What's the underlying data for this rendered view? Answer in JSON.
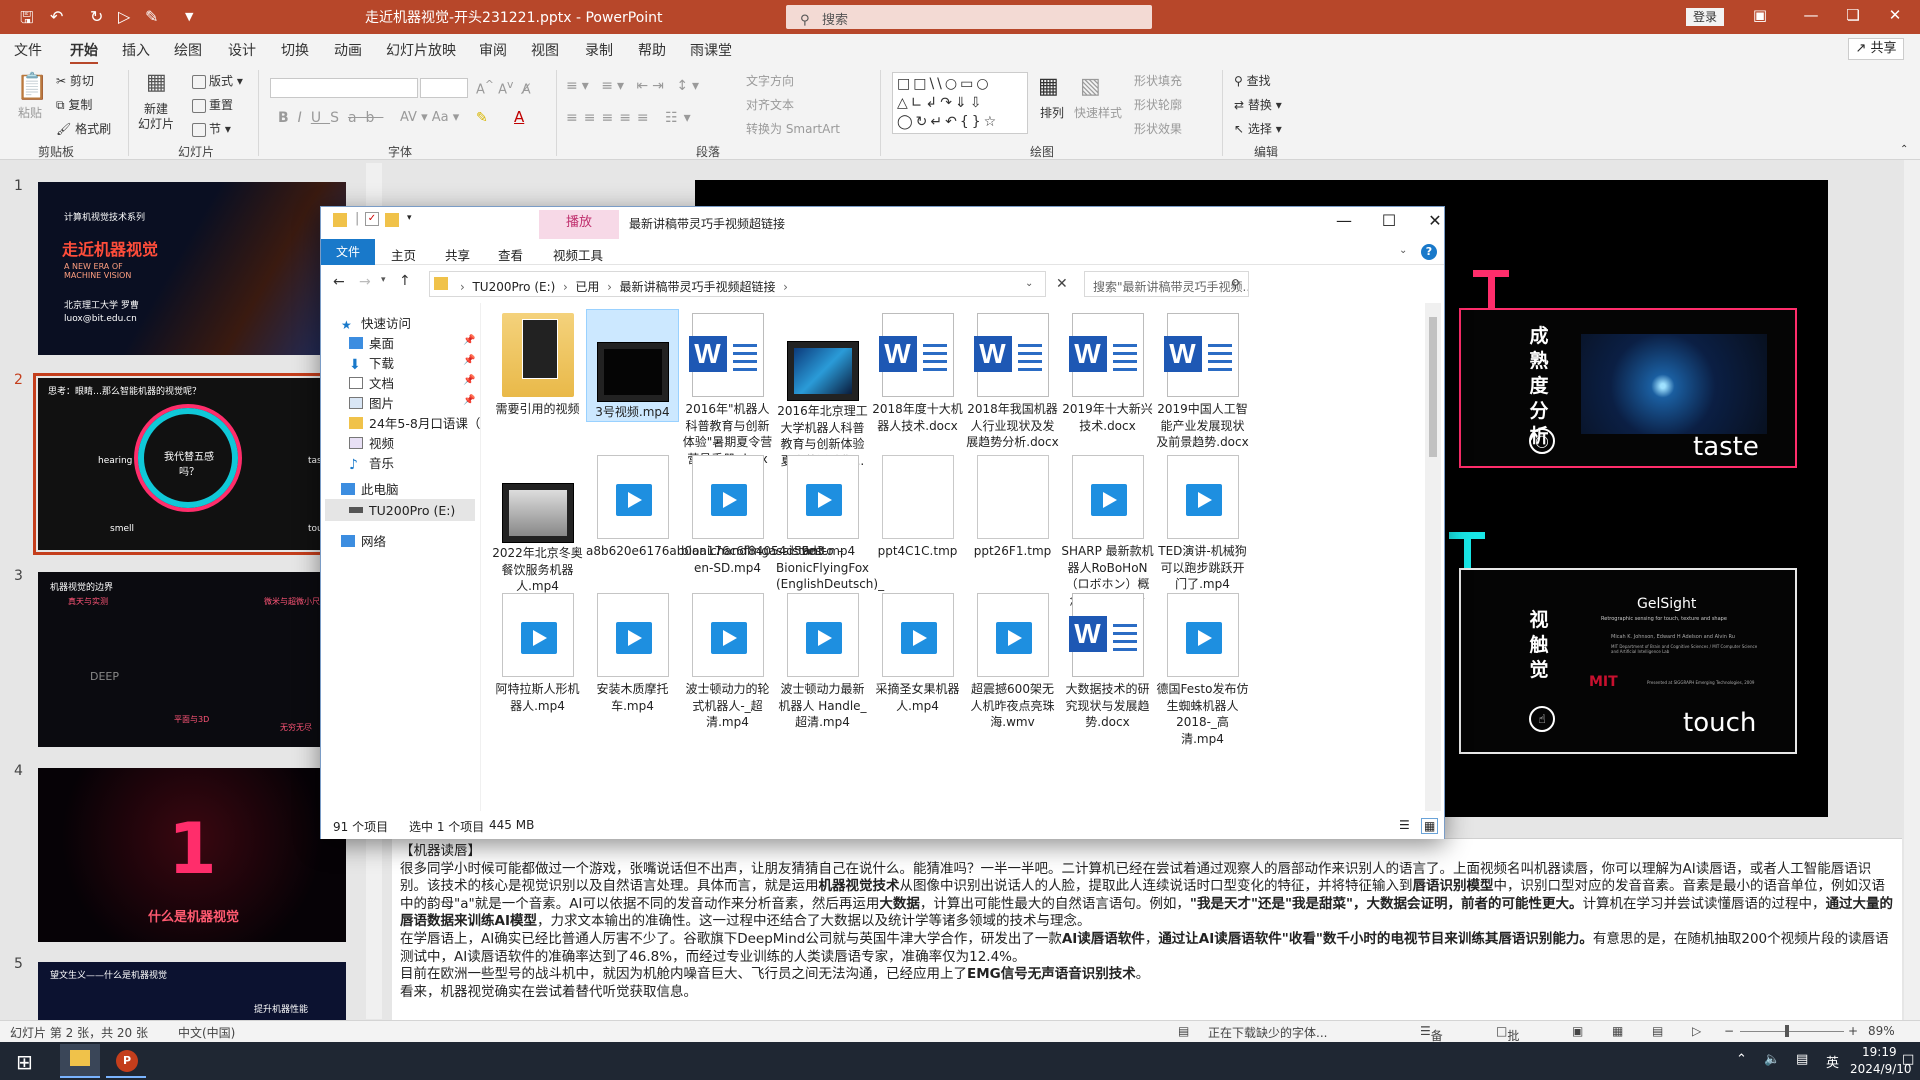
{
  "ppt": {
    "title": "走近机器视觉-开头231221.pptx - PowerPoint",
    "search_placeholder": "搜索",
    "login": "登录",
    "share": "共享",
    "menu": [
      "文件",
      "开始",
      "插入",
      "绘图",
      "设计",
      "切换",
      "动画",
      "幻灯片放映",
      "审阅",
      "视图",
      "录制",
      "帮助",
      "雨课堂"
    ],
    "ribbon": {
      "paste": "粘贴",
      "cut": "剪切",
      "copy": "复制",
      "format_painter": "格式刷",
      "new_slide": "新建\n幻灯片",
      "layout": "版式",
      "reset": "重置",
      "section": "节",
      "text_direction": "文字方向",
      "align_text": "对齐文本",
      "smartart": "转换为 SmartArt",
      "arrange": "排列",
      "quick_styles": "快速样式",
      "shape_fill": "形状填充",
      "shape_outline": "形状轮廓",
      "shape_effects": "形状效果",
      "find": "查找",
      "replace": "替换",
      "select": "选择",
      "groups": [
        "剪贴板",
        "幻灯片",
        "字体",
        "段落",
        "绘图",
        "编辑"
      ]
    },
    "slides": [
      {
        "num": "1",
        "title": "走近机器视觉",
        "subtitle": "A NEW ERA OF MACHINE VISION",
        "series": "计算机视觉技术系列",
        "author": "北京理工大学 罗曹",
        "email": "luox@bit.edu.cn"
      },
      {
        "num": "2",
        "title": "思考：眼睛…那么智能机器的视觉呢？",
        "center": "我代替五感吗？",
        "labels": [
          "hearing",
          "smell",
          "taste",
          "touch"
        ]
      },
      {
        "num": "3",
        "title": "机器视觉的边界",
        "left": "真天与实测",
        "right": "微米与超微小尺度",
        "bottom": "DEEP",
        "right2": "平面与3D",
        "tag": "无穷无尽"
      },
      {
        "num": "4",
        "title": "什么是机器视觉"
      },
      {
        "num": "5",
        "title": "望文生义——什么是机器视觉",
        "sub": "提升机器性能"
      }
    ],
    "main_slide": {
      "v1": "成熟度分析",
      "taste": "taste",
      "v2": "视触觉",
      "touch": "touch",
      "gelsight_title": "GelSight",
      "gelsight_sub": "Retrographic sensing for touch, texture and shape",
      "gelsight_authors": "Micah K. Johnson, Edward H Adelson and Alvin Ru",
      "gelsight_inst": "MIT Department of Brain and Cognitive Sciences / MIT Computer Science and Artificial Intelligence Lab",
      "gelsight_note": "Presented at SIGGRAPH Emerging Technologies, 2009"
    },
    "notes": {
      "heading": "【机器读唇】",
      "p1a": "很多同学小时候可能都做过一个游戏，张嘴说话但不出声，让朋友猜猜自己在说什么。能猜准吗？一半一半吧。二计算机已经在尝试着通过观察人的唇部动作来识别人的语言了。上面视频名叫机器读唇，你可以理解为AI读唇语，或者人工智能唇语识别。该技术的核心是视觉识别以及自然语言处理。具体而言，就是运用",
      "p1b": "机器视觉技术",
      "p1c": "从图像中识别出说话人的人脸，提取此人连续说话时口型变化的特征，并将特征输入到",
      "p1d": "唇语识别模型",
      "p1e": "中，识别口型对应的发音音素。音素是最小的语音单位，例如汉语中的韵母\"a\"就是一个音素。AI可以依据不同的发音动作来分析音素，然后再运用",
      "p1f": "大数据",
      "p1g": "，计算出可能性最大的自然语言语句。例如，",
      "p1h": "\"我是天才\"还是\"我是甜菜\"，大数据会证明，前者的可能性更大。",
      "p1i": "计算机在学习并尝试读懂唇语的过程中，",
      "p1j": "通过大量的唇语数据来训练AI模型",
      "p1k": "，力求文本输出的准确性。这一过程中还结合了大数据以及统计学等诸多领域的技术与理念。",
      "p2a": "在学唇语上，AI确实已经比普通人厉害不少了。谷歌旗下DeepMind公司就与英国牛津大学合作，研发出了一款",
      "p2b": "AI读唇语软件",
      "p2c": "，",
      "p2d": "通过让AI读唇语软件\"收看\"数千小时的电视节目来训练其唇语识别能力。",
      "p2e": "有意思的是，在随机抽取200个视频片段的读唇语测试中，AI读唇语软件的准确率达到了46.8%，而经过专业训练的人类读唇语专家，准确率仅为12.4%。",
      "p3a": "目前在欧洲一些型号的战斗机中，就因为机舱内噪音巨大、飞行员之间无法沟通，已经应用上了",
      "p3b": "EMG信号无声语音识别技术",
      "p3c": "。",
      "p4": "看来，机器视觉确实在尝试着替代听觉获取信息。"
    },
    "status": {
      "slide_info": "幻灯片 第 2 张，共 20 张",
      "lang": "中文(中国)",
      "downloading": "正在下载缺少的字体...",
      "notes_btn": "备注",
      "comments_btn": "批注",
      "zoom": "89%"
    },
    "taskbar": {
      "time": "19:19",
      "date": "2024/9/10",
      "ime": "英"
    }
  },
  "explorer": {
    "title": "最新讲稿带灵巧手视频超链接",
    "ctx_tab": "播放",
    "tabs": [
      "文件",
      "主页",
      "共享",
      "查看",
      "视频工具"
    ],
    "path": [
      "TU200Pro (E:)",
      "已用",
      "最新讲稿带灵巧手视频超链接"
    ],
    "search_placeholder": "搜索\"最新讲稿带灵巧手视频...",
    "nav": {
      "quick": "快速访问",
      "items": [
        "桌面",
        "下载",
        "文档",
        "图片",
        "24年5-8月口语课（",
        "视频",
        "音乐"
      ],
      "pc": "此电脑",
      "drive": "TU200Pro (E:)",
      "network": "网络"
    },
    "files": [
      {
        "name": "需要引用的视频",
        "type": "folder"
      },
      {
        "name": "3号视频.mp4",
        "type": "film",
        "selected": true
      },
      {
        "name": "2016年\"机器人科普教育与创新体验\"暑期夏令营营员手册.docx",
        "type": "word"
      },
      {
        "name": "2016年北京理工大学机器人科普教育与创新体验夏令营活动集...",
        "type": "film2"
      },
      {
        "name": "2018年度十大机器人技术.docx",
        "type": "word"
      },
      {
        "name": "2018年我国机器人行业现状及发展趋势分析.docx",
        "type": "word"
      },
      {
        "name": "2019年十大新兴技术.docx",
        "type": "word"
      },
      {
        "name": "2019中国人工智能产业发展现状及前景趋势.docx",
        "type": "word"
      },
      {
        "name": "2022年北京冬奥餐饮服务机器人.mp4",
        "type": "film3"
      },
      {
        "name": "a8b620e6176ab0aa176c6f84054d59d3.mp4",
        "type": "video"
      },
      {
        "name": "bionichandlingassistant-en-SD.mp4",
        "type": "video"
      },
      {
        "name": "Festo – BionicFlyingFox (EnglishDeutsch)_超清.mp4",
        "type": "video"
      },
      {
        "name": "ppt4C1C.tmp",
        "type": "blank"
      },
      {
        "name": "ppt26F1.tmp",
        "type": "blank"
      },
      {
        "name": "SHARP 最新款机器人RoBoHoN（ロボホン）概念手机 宣传片_...",
        "type": "video"
      },
      {
        "name": "TED演讲-机械狗可以跑步跳跃开门了.mp4",
        "type": "video"
      },
      {
        "name": "阿特拉斯人形机器人.mp4",
        "type": "video"
      },
      {
        "name": "安装木质摩托车.mp4",
        "type": "video"
      },
      {
        "name": "波士顿动力的轮式机器人-_超清.mp4",
        "type": "video"
      },
      {
        "name": "波士顿动力最新机器人 Handle_超清.mp4",
        "type": "video"
      },
      {
        "name": "采摘圣女果机器人.mp4",
        "type": "video"
      },
      {
        "name": "超震撼600架无人机昨夜点亮珠海.wmv",
        "type": "video"
      },
      {
        "name": "大数据技术的研究现状与发展趋势.docx",
        "type": "word"
      },
      {
        "name": "德国Festo发布仿生蜘蛛机器人2018-_高清.mp4",
        "type": "video"
      }
    ],
    "status": {
      "count": "91 个项目",
      "selected": "选中 1 个项目",
      "size": "445 MB"
    }
  }
}
